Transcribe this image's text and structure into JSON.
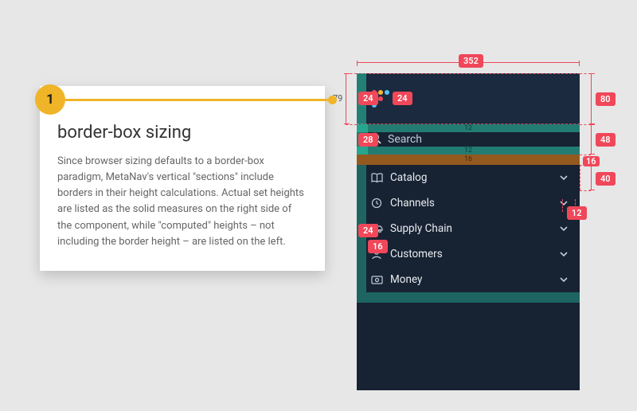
{
  "tooltip": {
    "step": "1",
    "title": "border-box sizing",
    "body": "Since browser sizing defaults to a border-box paradigm, MetaNav's vertical \"sections\" include borders in their height calculations. Actual set heights are listed as the solid measures on the right side of the component, while \"computed\" heights – not including the border height – are listed on the left."
  },
  "dims": {
    "top_width": "352",
    "left_header": "79",
    "right_header": "80",
    "right_search": "48",
    "right_item": "40",
    "left_header_pill": "24",
    "left_search_pill": "28",
    "left_item_pill": "24",
    "logo_pill": "24",
    "search_strip_top": "12",
    "search_strip_bot": "12",
    "divider_num": "16",
    "chevron_pill": "12",
    "customers_icon_pill": "16",
    "item_right_pad": "16"
  },
  "search": {
    "placeholder": "Search"
  },
  "sidebar": {
    "items": [
      {
        "label": "Catalog"
      },
      {
        "label": "Channels"
      },
      {
        "label": "Supply Chain"
      },
      {
        "label": "Customers"
      },
      {
        "label": "Money"
      }
    ]
  }
}
